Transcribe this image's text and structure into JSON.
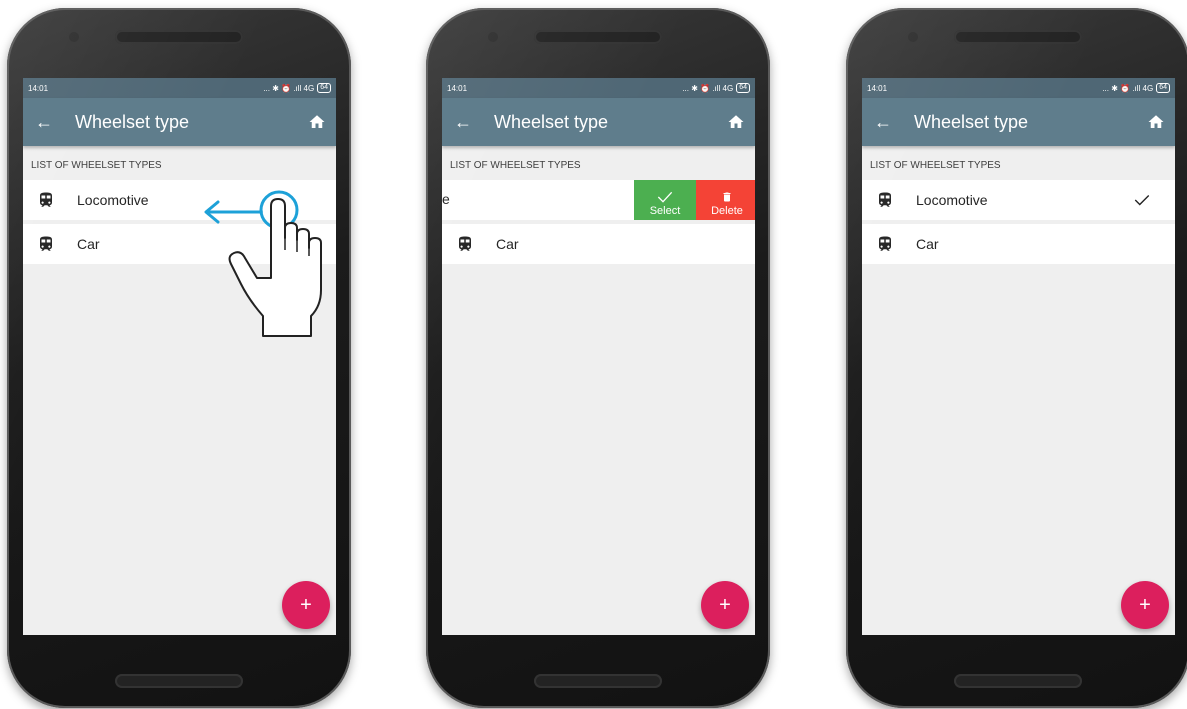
{
  "status": {
    "time": "14:01",
    "indicators": "... ✱ ⏰ .ıll 4G",
    "battery": "64"
  },
  "appbar": {
    "title": "Wheelset type",
    "back_icon": "←"
  },
  "list": {
    "header": "LIST OF WHEELSET TYPES",
    "items": [
      "Locomotive",
      "Car"
    ]
  },
  "swipe_actions": {
    "select": "Select",
    "delete": "Delete",
    "partial_text": "e"
  },
  "fab": {
    "label": "+"
  },
  "colors": {
    "appbar": "#5f7d8c",
    "statusbar": "#4f6775",
    "fab": "#dc1f5d",
    "select": "#4caf50",
    "delete": "#f44336",
    "gesture": "#1da1d8"
  },
  "icons": [
    "arrow-back-icon",
    "home-icon",
    "train-icon",
    "check-icon",
    "delete-icon",
    "add-icon",
    "swipe-hand-icon"
  ]
}
